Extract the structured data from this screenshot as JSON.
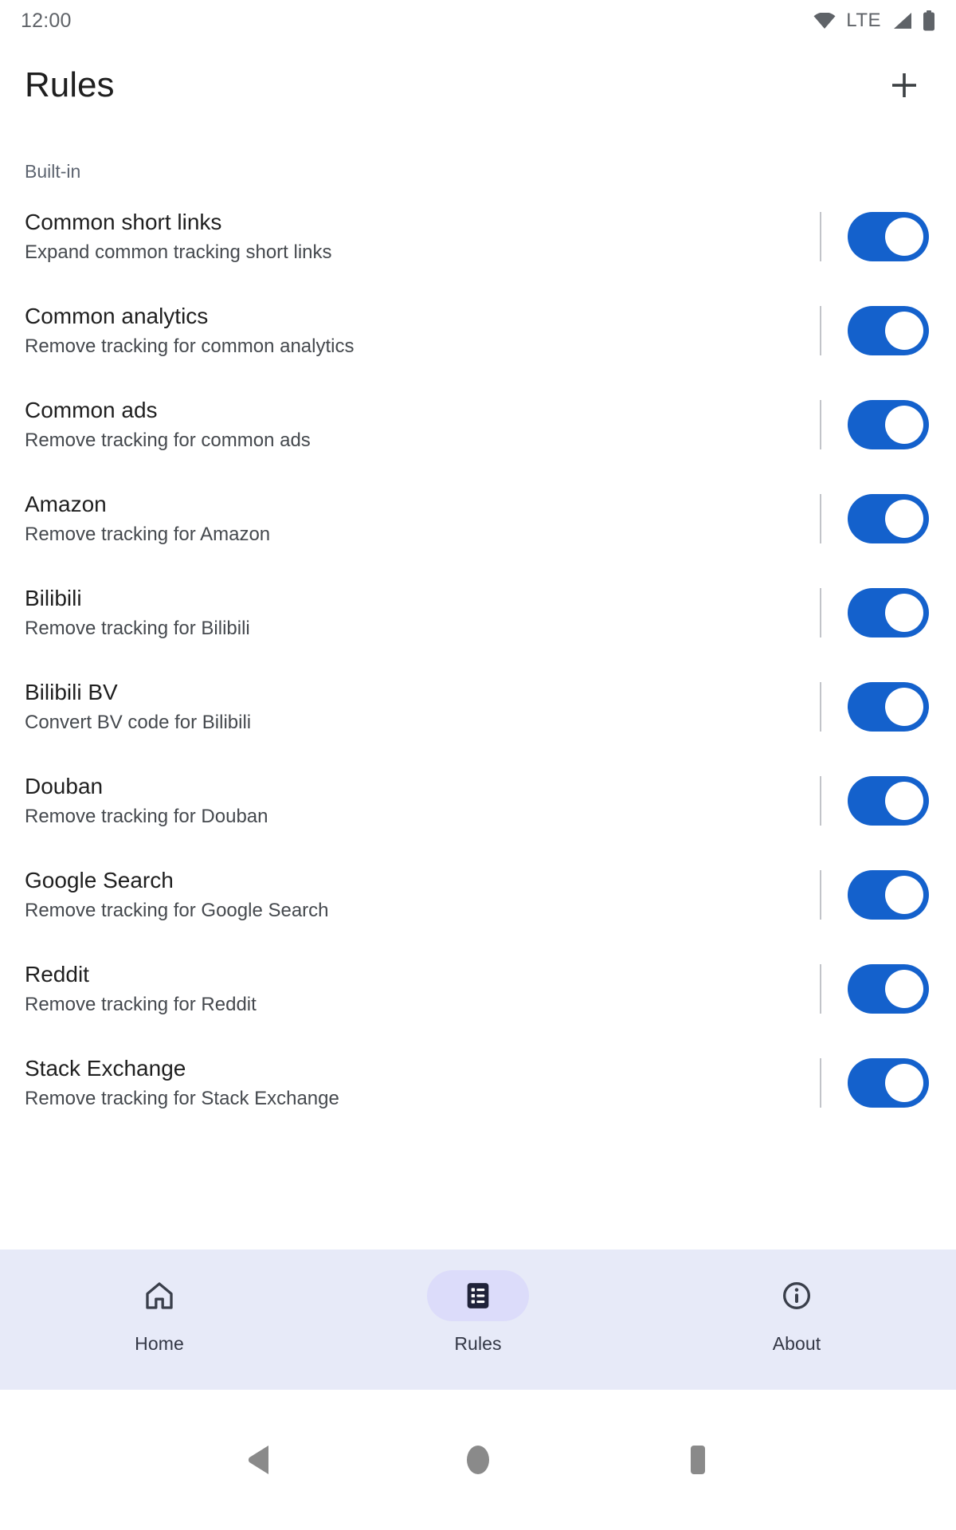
{
  "status_bar": {
    "time": "12:00",
    "network_label": "LTE",
    "icons": [
      "wifi-icon",
      "signal-icon",
      "battery-icon"
    ]
  },
  "app_bar": {
    "title": "Rules",
    "add_button_label": "+",
    "add_button_icon": "plus-icon"
  },
  "colors": {
    "switch_on": "#1461cc",
    "nav_background": "#e7eaf8",
    "nav_pill_selected": "#dcdcfa",
    "title_text": "#1f1f1f",
    "subtitle_text": "#45494e",
    "section_header_text": "#5d6470",
    "divider": "#c2c4c9",
    "system_nav_glyph": "#8a8a8a"
  },
  "content": {
    "section_header": "Built-in",
    "rules": [
      {
        "title": "Common short links",
        "subtitle": "Expand common tracking short links",
        "enabled": true
      },
      {
        "title": "Common analytics",
        "subtitle": "Remove tracking for common analytics",
        "enabled": true
      },
      {
        "title": "Common ads",
        "subtitle": "Remove tracking for common ads",
        "enabled": true
      },
      {
        "title": "Amazon",
        "subtitle": "Remove tracking for Amazon",
        "enabled": true
      },
      {
        "title": "Bilibili",
        "subtitle": "Remove tracking for Bilibili",
        "enabled": true
      },
      {
        "title": "Bilibili BV",
        "subtitle": "Convert BV code for Bilibili",
        "enabled": true
      },
      {
        "title": "Douban",
        "subtitle": "Remove tracking for Douban",
        "enabled": true
      },
      {
        "title": "Google Search",
        "subtitle": "Remove tracking for Google Search",
        "enabled": true
      },
      {
        "title": "Reddit",
        "subtitle": "Remove tracking for Reddit",
        "enabled": true
      },
      {
        "title": "Stack Exchange",
        "subtitle": "Remove tracking for Stack Exchange",
        "enabled": true
      }
    ]
  },
  "bottom_nav": {
    "items": [
      {
        "label": "Home",
        "icon": "home-icon",
        "selected": false
      },
      {
        "label": "Rules",
        "icon": "list-icon",
        "selected": true
      },
      {
        "label": "About",
        "icon": "info-icon",
        "selected": false
      }
    ]
  },
  "system_nav": {
    "buttons": [
      {
        "name": "back-button",
        "icon": "triangle-left-icon"
      },
      {
        "name": "home-button",
        "icon": "circle-icon"
      },
      {
        "name": "recents-button",
        "icon": "square-icon"
      }
    ]
  }
}
